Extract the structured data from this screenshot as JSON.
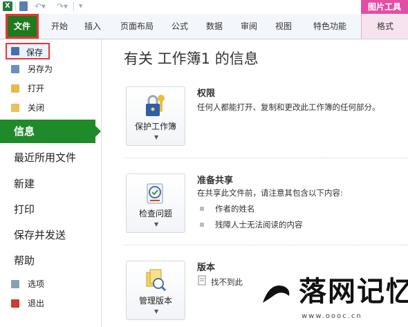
{
  "quick_access": {
    "app_icon_letter": "X",
    "icons": [
      "excel-app-icon",
      "save-icon",
      "undo-icon",
      "redo-icon",
      "customize-toolbar-icon"
    ]
  },
  "contextual_group": {
    "label": "图片工具"
  },
  "ribbon_tabs": [
    {
      "label": "文件"
    },
    {
      "label": "开始"
    },
    {
      "label": "插入"
    },
    {
      "label": "页面布局"
    },
    {
      "label": "公式"
    },
    {
      "label": "数据"
    },
    {
      "label": "审阅"
    },
    {
      "label": "视图"
    },
    {
      "label": "特色功能"
    },
    {
      "label": "格式"
    }
  ],
  "backstage": {
    "commands": [
      {
        "label": "保存",
        "icon": "save-icon"
      },
      {
        "label": "另存为",
        "icon": "save-as-icon"
      },
      {
        "label": "打开",
        "icon": "open-folder-icon"
      },
      {
        "label": "关闭",
        "icon": "close-folder-icon"
      }
    ],
    "nav": [
      {
        "label": "信息"
      },
      {
        "label": "最近所用文件"
      },
      {
        "label": "新建"
      },
      {
        "label": "打印"
      },
      {
        "label": "保存并发送"
      },
      {
        "label": "帮助"
      }
    ],
    "footer": [
      {
        "label": "选项",
        "icon": "options-icon"
      },
      {
        "label": "退出",
        "icon": "exit-icon"
      }
    ]
  },
  "info": {
    "title": "有关 工作簿1 的信息",
    "sections": [
      {
        "button_label": "保护工作簿",
        "heading": "权限",
        "text": "任何人都能打开、复制和更改此工作簿的任何部分。"
      },
      {
        "button_label": "检查问题",
        "heading": "准备共享",
        "text": "在共享此文件前，请注意其包含以下内容:",
        "bullets": [
          "作者的姓名",
          "残障人士无法阅读的内容"
        ]
      },
      {
        "button_label": "管理版本",
        "heading": "版本",
        "text": "找不到此"
      }
    ]
  },
  "watermark": {
    "text": "落网记忆",
    "url": "www.oooc.cn"
  },
  "colors": {
    "file_tab": "#1f7a1f",
    "active_nav": "#1f8a2a",
    "context_tab": "#e14fa4",
    "highlight": "#e33333"
  }
}
